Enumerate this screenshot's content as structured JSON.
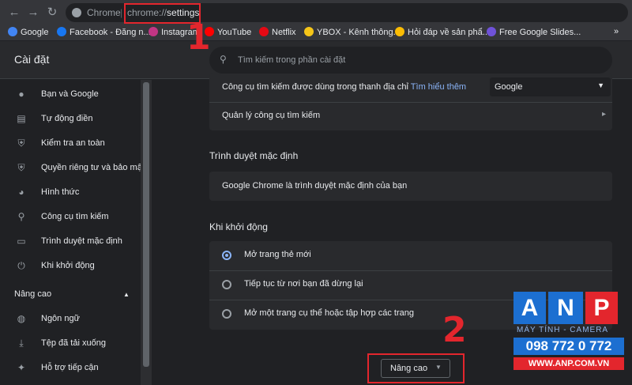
{
  "browser": {
    "tab_label": "Chrome",
    "url_scheme": "chrome://",
    "url_path": "settings"
  },
  "bookmarks": [
    {
      "label": "Google",
      "icon": "google-icon",
      "color": "#4285f4"
    },
    {
      "label": "Facebook - Đăng n...",
      "icon": "facebook-icon",
      "color": "#1877f2"
    },
    {
      "label": "Instagram",
      "icon": "instagram-icon",
      "color": "#c13584"
    },
    {
      "label": "YouTube",
      "icon": "youtube-icon",
      "color": "#ff0000"
    },
    {
      "label": "Netflix",
      "icon": "netflix-icon",
      "color": "#e50914"
    },
    {
      "label": "YBOX - Kênh thông...",
      "icon": "ybox-icon",
      "color": "#f5c518"
    },
    {
      "label": "Hỏi đáp về sản phẩ...",
      "icon": "qa-icon",
      "color": "#fbbc04"
    },
    {
      "label": "Free Google Slides...",
      "icon": "slides-icon",
      "color": "#6f52d9"
    }
  ],
  "bookmarks_more": "»",
  "settings": {
    "title": "Cài đặt",
    "search_placeholder": "Tìm kiếm trong phần cài đặt"
  },
  "sidebar": {
    "items": [
      {
        "label": "Bạn và Google",
        "icon": "person-icon"
      },
      {
        "label": "Tự động điền",
        "icon": "clipboard-icon"
      },
      {
        "label": "Kiểm tra an toàn",
        "icon": "shield-check-icon"
      },
      {
        "label": "Quyền riêng tư và bảo mật",
        "icon": "shield-icon"
      },
      {
        "label": "Hình thức",
        "icon": "palette-icon"
      },
      {
        "label": "Công cụ tìm kiếm",
        "icon": "search-icon"
      },
      {
        "label": "Trình duyệt mặc định",
        "icon": "browser-icon"
      },
      {
        "label": "Khi khởi động",
        "icon": "power-icon"
      }
    ],
    "advanced_label": "Nâng cao",
    "advanced_items": [
      {
        "label": "Ngôn ngữ",
        "icon": "globe-icon"
      },
      {
        "label": "Tệp đã tải xuống",
        "icon": "download-icon"
      },
      {
        "label": "Hỗ trợ tiếp cận",
        "icon": "accessibility-icon"
      }
    ]
  },
  "search_engine": {
    "row_text": "Công cụ tìm kiếm được dùng trong thanh địa chỉ",
    "learn_more": "Tìm hiểu thêm",
    "selected": "Google",
    "manage_label": "Quản lý công cụ tìm kiếm"
  },
  "default_browser": {
    "section_title": "Trình duyệt mặc định",
    "status": "Google Chrome là trình duyệt mặc định của bạn"
  },
  "startup": {
    "section_title": "Khi khởi động",
    "options": [
      {
        "label": "Mở trang thẻ mới",
        "selected": true
      },
      {
        "label": "Tiếp tục từ nơi bạn đã dừng lại",
        "selected": false
      },
      {
        "label": "Mở một trang cụ thể hoặc tập hợp các trang",
        "selected": false
      }
    ]
  },
  "advanced_button": "Nâng cao",
  "annotations": {
    "step1": "1",
    "step2": "2",
    "color": "#e3262d"
  },
  "watermark": {
    "letters": [
      "A",
      "N",
      "P"
    ],
    "line1": "MÁY TÍNH - CAMERA",
    "phone": "098 772 0 772",
    "site": "WWW.ANP.COM.VN"
  }
}
